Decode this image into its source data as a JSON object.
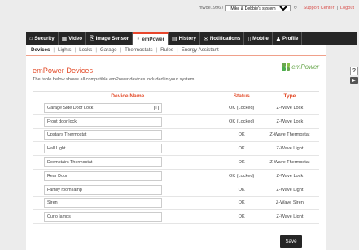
{
  "header": {
    "user": "mwde1996 /",
    "system": "Mike & Debbie's system",
    "refresh_icon": "refresh-icon",
    "sep1": "|",
    "support": "Support Center",
    "sep2": "|",
    "logout": "Logout"
  },
  "nav": {
    "tabs": [
      {
        "label": "Security",
        "icon": "⌂"
      },
      {
        "label": "Video",
        "icon": "▦"
      },
      {
        "label": "Image Sensor",
        "icon": "⎘"
      },
      {
        "label": "emPower",
        "icon": "♀"
      },
      {
        "label": "History",
        "icon": "▤"
      },
      {
        "label": "Notifications",
        "icon": "✉"
      },
      {
        "label": "Mobile",
        "icon": "▯"
      },
      {
        "label": "Profile",
        "icon": "♟"
      }
    ]
  },
  "subnav": {
    "items": [
      "Devices",
      "Lights",
      "Locks",
      "Garage",
      "Thermostats",
      "Rules",
      "Energy Assistant"
    ]
  },
  "page": {
    "title": "emPower Devices",
    "description": "The table below shows all compatible emPower devices included in your system.",
    "logo_text": "emPower"
  },
  "table": {
    "headers": [
      "Device Name",
      "Status",
      "Type"
    ],
    "rows": [
      {
        "name": "Garage Side Door Lock",
        "status": "OK (Locked)",
        "type": "Z-Wave Lock"
      },
      {
        "name": "Front door lock",
        "status": "OK (Locked)",
        "type": "Z-Wave Lock"
      },
      {
        "name": "Upstairs Thermostat",
        "status": "OK",
        "type": "Z-Wave Thermostat"
      },
      {
        "name": "Hall Light",
        "status": "OK",
        "type": "Z-Wave Light"
      },
      {
        "name": "Downstairs Thermostat",
        "status": "OK",
        "type": "Z-Wave Thermostat"
      },
      {
        "name": "Rear Door",
        "status": "OK (Locked)",
        "type": "Z-Wave Lock"
      },
      {
        "name": "Family room lamp",
        "status": "OK",
        "type": "Z-Wave Light"
      },
      {
        "name": "Siren",
        "status": "OK",
        "type": "Z-Wave Siren"
      },
      {
        "name": "Curio lamps",
        "status": "OK",
        "type": "Z-Wave Light"
      }
    ]
  },
  "actions": {
    "save": "Save",
    "help": "?"
  }
}
